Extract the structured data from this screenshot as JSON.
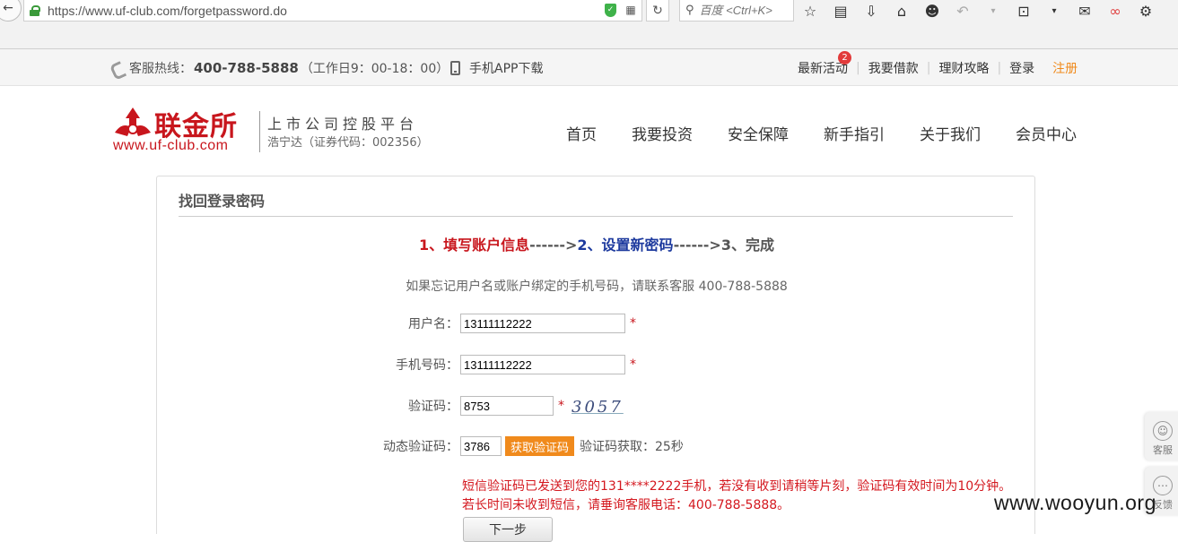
{
  "browser": {
    "url": "https://www.uf-club.com/forgetpassword.do",
    "search_placeholder": "百度 <Ctrl+K>"
  },
  "topbar": {
    "hotline_label": "客服热线：",
    "hotline_number": "400-788-5888",
    "hotline_hours": "（工作日9：00-18：00）",
    "app_download": "手机APP下载",
    "links": [
      {
        "label": "最新活动",
        "badge": "2"
      },
      {
        "label": "我要借款"
      },
      {
        "label": "理财攻略"
      },
      {
        "label": "登录"
      }
    ],
    "register": "注册"
  },
  "header": {
    "logo_cn": "联金所",
    "logo_domain": "www.uf-club.com",
    "tagline": "上市公司控股平台",
    "stock": "浩宁达（证券代码：002356）",
    "nav": [
      "首页",
      "我要投资",
      "安全保障",
      "新手指引",
      "关于我们",
      "会员中心"
    ]
  },
  "panel": {
    "title": "找回登录密码",
    "step1": "1、填写账户信息",
    "arrow1": "------>",
    "step2": "2、设置新密码",
    "arrow2": "------>",
    "step3": "3、完成",
    "hint": "如果忘记用户名或账户绑定的手机号码，请联系客服 400-788-5888",
    "required_mark": "*",
    "username": {
      "label": "用户名：",
      "value": "13111112222"
    },
    "phone": {
      "label": "手机号码：",
      "value": "13111112222"
    },
    "captcha": {
      "label": "验证码：",
      "value": "8753",
      "image_text": "3057"
    },
    "sms": {
      "label": "动态验证码：",
      "value": "3786",
      "button": "获取验证码",
      "countdown": "验证码获取：25秒"
    },
    "msg_line1": "短信验证码已发送到您的131****2222手机，若没有收到请稍等片刻，验证码有效时间为10分钟。",
    "msg_line2": "若长时间未收到短信，请垂询客服电话：400-788-5888。",
    "next_button": "下一步"
  },
  "side": {
    "service": "客服",
    "feedback": "反馈"
  },
  "watermark": "www.wooyun.org",
  "colors": {
    "brand_red": "#c8161d",
    "accent_orange": "#f08a1c",
    "step_blue": "#1d3a9e"
  }
}
